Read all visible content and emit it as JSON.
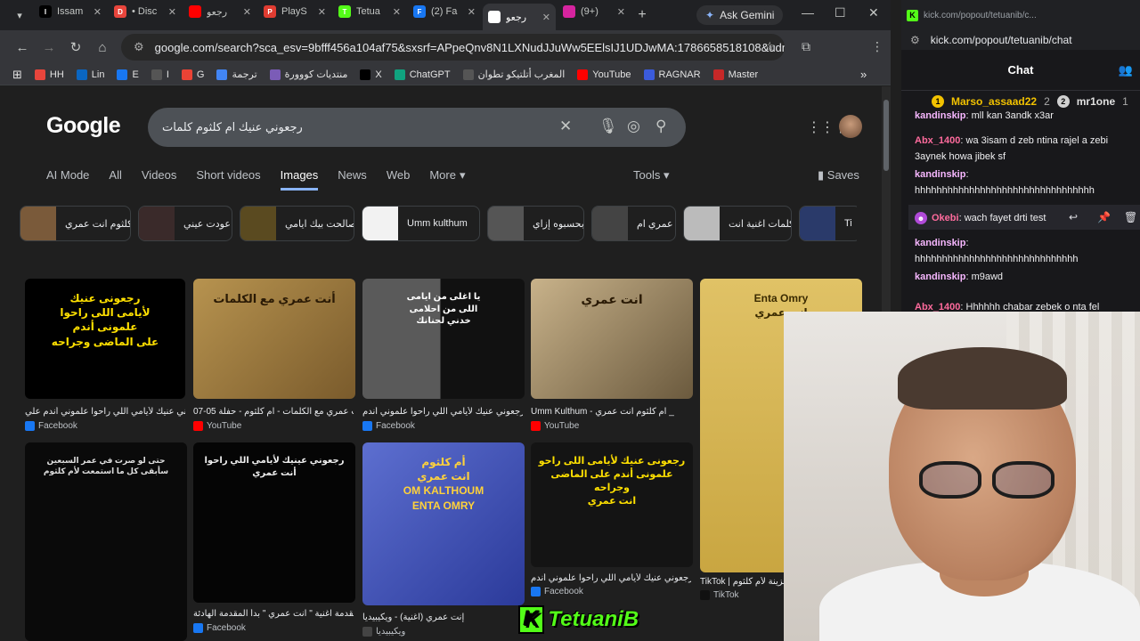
{
  "browser": {
    "tabs": [
      {
        "label": "Issam",
        "icon": "x-logo-icon",
        "color": "#000000"
      },
      {
        "label": "• Disc",
        "icon": "chrome-icon",
        "color": "#e8453c"
      },
      {
        "label": "رجعو",
        "icon": "youtube-icon",
        "color": "#ff0000"
      },
      {
        "label": "PlayS",
        "icon": "playstation-icon",
        "color": "#e03c31"
      },
      {
        "label": "Tetua",
        "icon": "kick-icon",
        "color": "#53fc18"
      },
      {
        "label": "(2) Fa",
        "icon": "facebook-icon",
        "color": "#1877f2"
      },
      {
        "label": "رجعو",
        "icon": "google-icon",
        "color": "#ffffff"
      },
      {
        "label": "(9+)",
        "icon": "instagram-icon",
        "color": "#d6249f"
      }
    ],
    "ask_gemini": "Ask Gemini",
    "url": "google.com/search?sca_esv=9bfff456a104af75&sxsrf=APpeQnv8N1LXNudJJuWw5EElsIJ1UDJwMA:1786658518108&udm=2&fbs=...",
    "bookmarks": [
      {
        "label": "HH",
        "color": "#e8453c"
      },
      {
        "label": "Lin",
        "color": "#0a66c2"
      },
      {
        "label": "E",
        "color": "#1877f2"
      },
      {
        "label": "I",
        "color": "#555555"
      },
      {
        "label": "G",
        "color": "#ea4335"
      },
      {
        "label": "ترجمة",
        "color": "#4285f4"
      },
      {
        "label": "منتديات كووورة",
        "color": "#7b5cb7"
      },
      {
        "label": "X",
        "color": "#000000"
      },
      {
        "label": "ChatGPT",
        "color": "#10a37f"
      },
      {
        "label": "المغرب أتلتيكو تطوان",
        "color": "#555555"
      },
      {
        "label": "YouTube",
        "color": "#ff0000"
      },
      {
        "label": "RAGNAR",
        "color": "#3b5bdb"
      },
      {
        "label": "Master",
        "color": "#c62828"
      }
    ]
  },
  "google": {
    "logo": "Google",
    "query": "رجعوني عنيك ام كلثوم كلمات",
    "tabs": [
      "AI Mode",
      "All",
      "Videos",
      "Short videos",
      "Images",
      "News",
      "Web",
      "More"
    ],
    "active_tab": "Images",
    "tools": "Tools",
    "saves": "Saves",
    "chips": [
      "كلثوم انت عمري",
      "عودت عيني",
      "صالحت بيك ايامي",
      "Umm kulthum",
      "بحسبوه إزاي",
      "عمري ام",
      "كلمات اغنية انت",
      "Ti"
    ],
    "results": [
      {
        "caption": "رجعوني عنيك لأيامي اللي راحوا علموني أندم علي...",
        "source": "Facebook",
        "src_color": "#1877f2",
        "art": "رجعونى عنيك\nلأيامى اللى راحوا\nعلمونى أندم\nعلى الماضى وجراحه"
      },
      {
        "caption": "أنت عمري مع الكلمات - ام كلثوم - حفلة 05-07-...",
        "source": "YouTube",
        "src_color": "#ff0000",
        "art": "أنت عمري مع الكلمات"
      },
      {
        "caption": "كل - رجعوني عنيك لأيامي اللي راحوا علموني أندم ...",
        "source": "Facebook",
        "src_color": "#1877f2",
        "art": "يا اغلى من ايامى\nاللى من احلامى\nخدني لحنانك"
      },
      {
        "caption": "Umm Kulthum - ام كلثوم انت عمري _",
        "source": "YouTube",
        "src_color": "#ff0000",
        "art": "انت عمري"
      },
      {
        "caption": "TikTok | كلمات حزينة لأم كلثوم",
        "source": "TikTok",
        "src_color": "#111111",
        "art": "Enta Omry\nانت عمري"
      },
      {
        "caption": "حتى لو صرت في عمر السبعين",
        "source": "",
        "src_color": "#000000",
        "art": "حتى لو صرت في عمر السبعين\nسأبقى كل ما استمعت لأم كلثوم"
      },
      {
        "caption": "تحليل مقدمة اغنية \" انت عمري \" بدأ المقدمة الهادئة",
        "source": "Facebook",
        "src_color": "#1877f2",
        "art": "رجعوني عينيك لأيامي اللي راحوا\nأنت عمري"
      },
      {
        "caption": "إنت عمري (اغنية) - ويكيبيديا",
        "source": "ويكيبيديا",
        "src_color": "#444444",
        "art": "أم كلثوم\nانت عمري\nOM KALTHOUM\nENTA OMRY"
      },
      {
        "caption": "كل - رجعوني عنيك لأيامي اللي راحوا علموني أندم ...",
        "source": "Facebook",
        "src_color": "#1877f2",
        "art": "رجعونى عنيك لأيامى اللى راحو\nعلمونى أندم على الماضى وجراحه\nانت عمري"
      }
    ]
  },
  "chat": {
    "window_title": "kick.com/popout/tetuanib/c...",
    "url": "kick.com/popout/tetuanib/chat",
    "header": "Chat",
    "pinned_users": [
      {
        "name": "Marso_assaad22",
        "count": "2",
        "badge": "1"
      },
      {
        "name": "mr1one",
        "count": "1",
        "badge": "2"
      }
    ],
    "messages": [
      {
        "user": "kandinskip",
        "color": "#f7b7ff",
        "text": "mll kan 3andk x3ar"
      },
      {
        "user": "Abx_1400",
        "color": "#ff6b9d",
        "text": "wa 3isam d zeb ntina rajel a zebi 3aynek howa jibek sf"
      },
      {
        "user": "kandinskip",
        "color": "#f7b7ff",
        "text": "hhhhhhhhhhhhhhhhhhhhhhhhhhhhhhhhh"
      },
      {
        "user": "Okebi",
        "color": "#ff6b9d",
        "text": "wach fayet drti test"
      },
      {
        "user": "kandinskip",
        "color": "#f7b7ff",
        "text": "hhhhhhhhhhhhhhhhhhhhhhhhhhhhhh"
      },
      {
        "user": "kandinskip",
        "color": "#f7b7ff",
        "text": "m9awd"
      },
      {
        "user": "Abx_1400",
        "color": "#ff6b9d",
        "text": "Hhhhhh chabar zebek o nta fel"
      }
    ]
  },
  "stream": {
    "watermark": "TetuaniB"
  }
}
